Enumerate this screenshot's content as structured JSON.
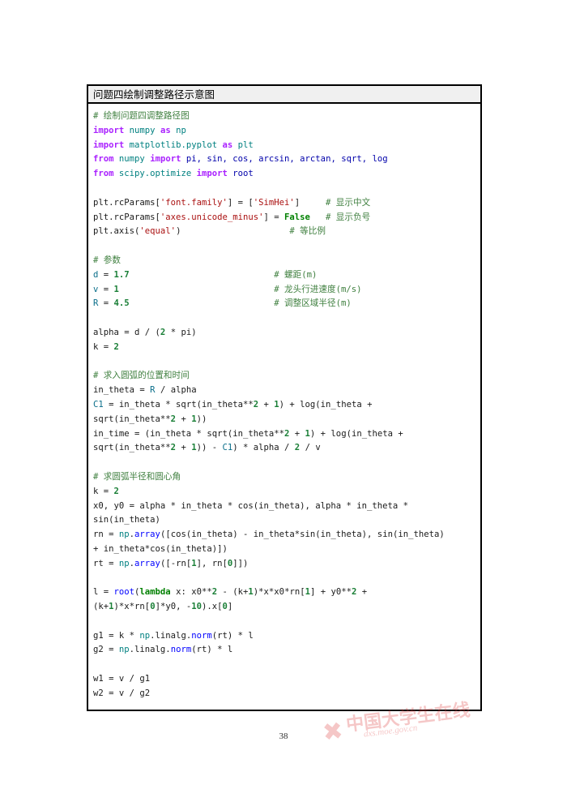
{
  "document": {
    "page_number": "38"
  },
  "listing": {
    "caption": "问题四绘制调整路径示意图",
    "lines": [
      [
        {
          "t": "cmt",
          "s": "# 绘制问题四调整路径图"
        }
      ],
      [
        {
          "t": "kw",
          "s": "import"
        },
        {
          "t": "plain",
          "s": " "
        },
        {
          "t": "builtin",
          "s": "numpy"
        },
        {
          "t": "plain",
          "s": " "
        },
        {
          "t": "kw",
          "s": "as"
        },
        {
          "t": "plain",
          "s": " "
        },
        {
          "t": "builtin",
          "s": "np"
        }
      ],
      [
        {
          "t": "kw",
          "s": "import"
        },
        {
          "t": "plain",
          "s": " "
        },
        {
          "t": "builtin",
          "s": "matplotlib.pyplot"
        },
        {
          "t": "plain",
          "s": " "
        },
        {
          "t": "kw",
          "s": "as"
        },
        {
          "t": "plain",
          "s": " "
        },
        {
          "t": "builtin",
          "s": "plt"
        }
      ],
      [
        {
          "t": "kw",
          "s": "from"
        },
        {
          "t": "plain",
          "s": " "
        },
        {
          "t": "builtin",
          "s": "numpy"
        },
        {
          "t": "plain",
          "s": " "
        },
        {
          "t": "kw",
          "s": "import"
        },
        {
          "t": "plain",
          "s": " "
        },
        {
          "t": "name",
          "s": "pi, sin, cos, arcsin, arctan, sqrt, log"
        }
      ],
      [
        {
          "t": "kw",
          "s": "from"
        },
        {
          "t": "plain",
          "s": " "
        },
        {
          "t": "builtin",
          "s": "scipy.optimize"
        },
        {
          "t": "plain",
          "s": " "
        },
        {
          "t": "kw",
          "s": "import"
        },
        {
          "t": "plain",
          "s": " "
        },
        {
          "t": "name",
          "s": "root"
        }
      ],
      [],
      [
        {
          "t": "plain",
          "s": "plt.rcParams["
        },
        {
          "t": "str",
          "s": "'font.family'"
        },
        {
          "t": "plain",
          "s": "] = ["
        },
        {
          "t": "str",
          "s": "'SimHei'"
        },
        {
          "t": "plain",
          "s": "]     "
        },
        {
          "t": "cmt",
          "s": "# 显示中文"
        }
      ],
      [
        {
          "t": "plain",
          "s": "plt.rcParams["
        },
        {
          "t": "str",
          "s": "'axes.unicode_minus'"
        },
        {
          "t": "plain",
          "s": "] = "
        },
        {
          "t": "kw2",
          "s": "False"
        },
        {
          "t": "plain",
          "s": "   "
        },
        {
          "t": "cmt",
          "s": "# 显示负号"
        }
      ],
      [
        {
          "t": "plain",
          "s": "plt.axis("
        },
        {
          "t": "str",
          "s": "'equal'"
        },
        {
          "t": "plain",
          "s": ")                     "
        },
        {
          "t": "cmt",
          "s": "# 等比例"
        }
      ],
      [],
      [
        {
          "t": "cmt",
          "s": "# 参数"
        }
      ],
      [
        {
          "t": "var",
          "s": "d"
        },
        {
          "t": "plain",
          "s": " = "
        },
        {
          "t": "num",
          "s": "1.7"
        },
        {
          "t": "plain",
          "s": "                            "
        },
        {
          "t": "cmt",
          "s": "# 螺距(m)"
        }
      ],
      [
        {
          "t": "var",
          "s": "v"
        },
        {
          "t": "plain",
          "s": " = "
        },
        {
          "t": "num",
          "s": "1"
        },
        {
          "t": "plain",
          "s": "                              "
        },
        {
          "t": "cmt",
          "s": "# 龙头行进速度(m/s)"
        }
      ],
      [
        {
          "t": "var",
          "s": "R"
        },
        {
          "t": "plain",
          "s": " = "
        },
        {
          "t": "num",
          "s": "4.5"
        },
        {
          "t": "plain",
          "s": "                            "
        },
        {
          "t": "cmt",
          "s": "# 调整区域半径(m)"
        }
      ],
      [],
      [
        {
          "t": "plain",
          "s": "alpha = d / ("
        },
        {
          "t": "num",
          "s": "2"
        },
        {
          "t": "plain",
          "s": " * pi)"
        }
      ],
      [
        {
          "t": "plain",
          "s": "k = "
        },
        {
          "t": "num",
          "s": "2"
        }
      ],
      [],
      [
        {
          "t": "cmt",
          "s": "# 求入圆弧的位置和时间"
        }
      ],
      [
        {
          "t": "plain",
          "s": "in_theta = "
        },
        {
          "t": "var",
          "s": "R"
        },
        {
          "t": "plain",
          "s": " / alpha"
        }
      ],
      [
        {
          "t": "var",
          "s": "C1"
        },
        {
          "t": "plain",
          "s": " = in_theta * sqrt(in_theta**"
        },
        {
          "t": "num",
          "s": "2"
        },
        {
          "t": "plain",
          "s": " + "
        },
        {
          "t": "num",
          "s": "1"
        },
        {
          "t": "plain",
          "s": ") + log(in_theta +"
        }
      ],
      [
        {
          "t": "plain",
          "s": "sqrt(in_theta**"
        },
        {
          "t": "num",
          "s": "2"
        },
        {
          "t": "plain",
          "s": " + "
        },
        {
          "t": "num",
          "s": "1"
        },
        {
          "t": "plain",
          "s": "))"
        }
      ],
      [
        {
          "t": "plain",
          "s": "in_time = (in_theta * sqrt(in_theta**"
        },
        {
          "t": "num",
          "s": "2"
        },
        {
          "t": "plain",
          "s": " + "
        },
        {
          "t": "num",
          "s": "1"
        },
        {
          "t": "plain",
          "s": ") + log(in_theta +"
        }
      ],
      [
        {
          "t": "plain",
          "s": "sqrt(in_theta**"
        },
        {
          "t": "num",
          "s": "2"
        },
        {
          "t": "plain",
          "s": " + "
        },
        {
          "t": "num",
          "s": "1"
        },
        {
          "t": "plain",
          "s": ")) - "
        },
        {
          "t": "var",
          "s": "C1"
        },
        {
          "t": "plain",
          "s": ") * alpha / "
        },
        {
          "t": "num",
          "s": "2"
        },
        {
          "t": "plain",
          "s": " / v"
        }
      ],
      [],
      [
        {
          "t": "cmt",
          "s": "# 求圆弧半径和圆心角"
        }
      ],
      [
        {
          "t": "plain",
          "s": "k = "
        },
        {
          "t": "num",
          "s": "2"
        }
      ],
      [
        {
          "t": "plain",
          "s": "x0, y0 = alpha * in_theta * cos(in_theta), alpha * in_theta *"
        }
      ],
      [
        {
          "t": "plain",
          "s": "sin(in_theta)"
        }
      ],
      [
        {
          "t": "plain",
          "s": "rn = "
        },
        {
          "t": "builtin",
          "s": "np"
        },
        {
          "t": "plain",
          "s": "."
        },
        {
          "t": "fn",
          "s": "array"
        },
        {
          "t": "plain",
          "s": "([cos(in_theta) - in_theta*sin(in_theta), sin(in_theta)"
        }
      ],
      [
        {
          "t": "plain",
          "s": "+ in_theta*cos(in_theta)])"
        }
      ],
      [
        {
          "t": "plain",
          "s": "rt = "
        },
        {
          "t": "builtin",
          "s": "np"
        },
        {
          "t": "plain",
          "s": "."
        },
        {
          "t": "fn",
          "s": "array"
        },
        {
          "t": "plain",
          "s": "([-rn["
        },
        {
          "t": "num",
          "s": "1"
        },
        {
          "t": "plain",
          "s": "], rn["
        },
        {
          "t": "num",
          "s": "0"
        },
        {
          "t": "plain",
          "s": "]])"
        }
      ],
      [],
      [
        {
          "t": "plain",
          "s": "l = "
        },
        {
          "t": "fn",
          "s": "root"
        },
        {
          "t": "plain",
          "s": "("
        },
        {
          "t": "kw2",
          "s": "lambda"
        },
        {
          "t": "plain",
          "s": " x: x0**"
        },
        {
          "t": "num",
          "s": "2"
        },
        {
          "t": "plain",
          "s": " - (k+"
        },
        {
          "t": "num",
          "s": "1"
        },
        {
          "t": "plain",
          "s": ")*x*x0*rn["
        },
        {
          "t": "num",
          "s": "1"
        },
        {
          "t": "plain",
          "s": "] + y0**"
        },
        {
          "t": "num",
          "s": "2"
        },
        {
          "t": "plain",
          "s": " +"
        }
      ],
      [
        {
          "t": "plain",
          "s": "(k+"
        },
        {
          "t": "num",
          "s": "1"
        },
        {
          "t": "plain",
          "s": ")*x*rn["
        },
        {
          "t": "num",
          "s": "0"
        },
        {
          "t": "plain",
          "s": "]*y0, -"
        },
        {
          "t": "num",
          "s": "10"
        },
        {
          "t": "plain",
          "s": ").x["
        },
        {
          "t": "num",
          "s": "0"
        },
        {
          "t": "plain",
          "s": "]"
        }
      ],
      [],
      [
        {
          "t": "plain",
          "s": "g1 = k * "
        },
        {
          "t": "builtin",
          "s": "np"
        },
        {
          "t": "plain",
          "s": ".linalg."
        },
        {
          "t": "fn",
          "s": "norm"
        },
        {
          "t": "plain",
          "s": "(rt) * l"
        }
      ],
      [
        {
          "t": "plain",
          "s": "g2 = "
        },
        {
          "t": "builtin",
          "s": "np"
        },
        {
          "t": "plain",
          "s": ".linalg."
        },
        {
          "t": "fn",
          "s": "norm"
        },
        {
          "t": "plain",
          "s": "(rt) * l"
        }
      ],
      [],
      [
        {
          "t": "plain",
          "s": "w1 = v / g1"
        }
      ],
      [
        {
          "t": "plain",
          "s": "w2 = v / g2"
        }
      ]
    ]
  },
  "watermark": {
    "star": "✖",
    "text_cn": "中国大学生在线",
    "url": "dxs.moe.gov.cn",
    "color": "#e0484a"
  }
}
